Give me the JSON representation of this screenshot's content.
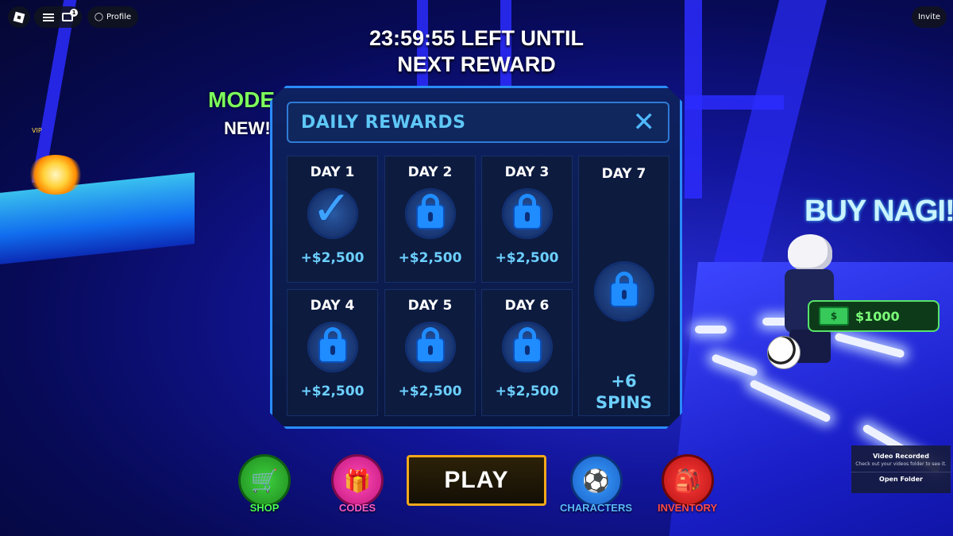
{
  "topbar": {
    "profile_label": "Profile",
    "invite_label": "Invite",
    "chat_badge": "1"
  },
  "timer": {
    "line1": "23:59:55 LEFT UNTIL",
    "line2": "NEXT REWARD"
  },
  "world": {
    "mode_text": "MODE",
    "new_text": "NEW!!",
    "vip_text": "VIP",
    "buy_text": "BUY NAGI!",
    "price_text": "$1000",
    "bill_symbol": "$"
  },
  "modal": {
    "title": "DAILY REWARDS",
    "close_glyph": "✕",
    "days": [
      {
        "label": "DAY 1",
        "reward": "+$2,500",
        "status": "claimed"
      },
      {
        "label": "DAY 2",
        "reward": "+$2,500",
        "status": "locked"
      },
      {
        "label": "DAY 3",
        "reward": "+$2,500",
        "status": "locked"
      },
      {
        "label": "DAY 4",
        "reward": "+$2,500",
        "status": "locked"
      },
      {
        "label": "DAY 5",
        "reward": "+$2,500",
        "status": "locked"
      },
      {
        "label": "DAY 6",
        "reward": "+$2,500",
        "status": "locked"
      }
    ],
    "day7": {
      "label": "DAY 7",
      "reward_line1": "+6",
      "reward_line2": "SPINS",
      "status": "locked"
    }
  },
  "bottom": {
    "shop": "SHOP",
    "codes": "CODES",
    "play": "PLAY",
    "characters": "CHARACTERS",
    "inventory": "INVENTORY"
  },
  "toast": {
    "title": "Video Recorded",
    "subtitle": "Check out your videos folder to see it.",
    "button": "Open Folder"
  },
  "colors": {
    "accent": "#5ec7f5",
    "reward": "#6cd0ff",
    "play_border": "#f2a81b",
    "shop": "#4cff4c",
    "codes": "#ff5ac4",
    "characters": "#5ab8ff",
    "inventory": "#ff4a4a"
  },
  "icons": {
    "claimed": "check-icon",
    "locked": "lock-icon"
  }
}
